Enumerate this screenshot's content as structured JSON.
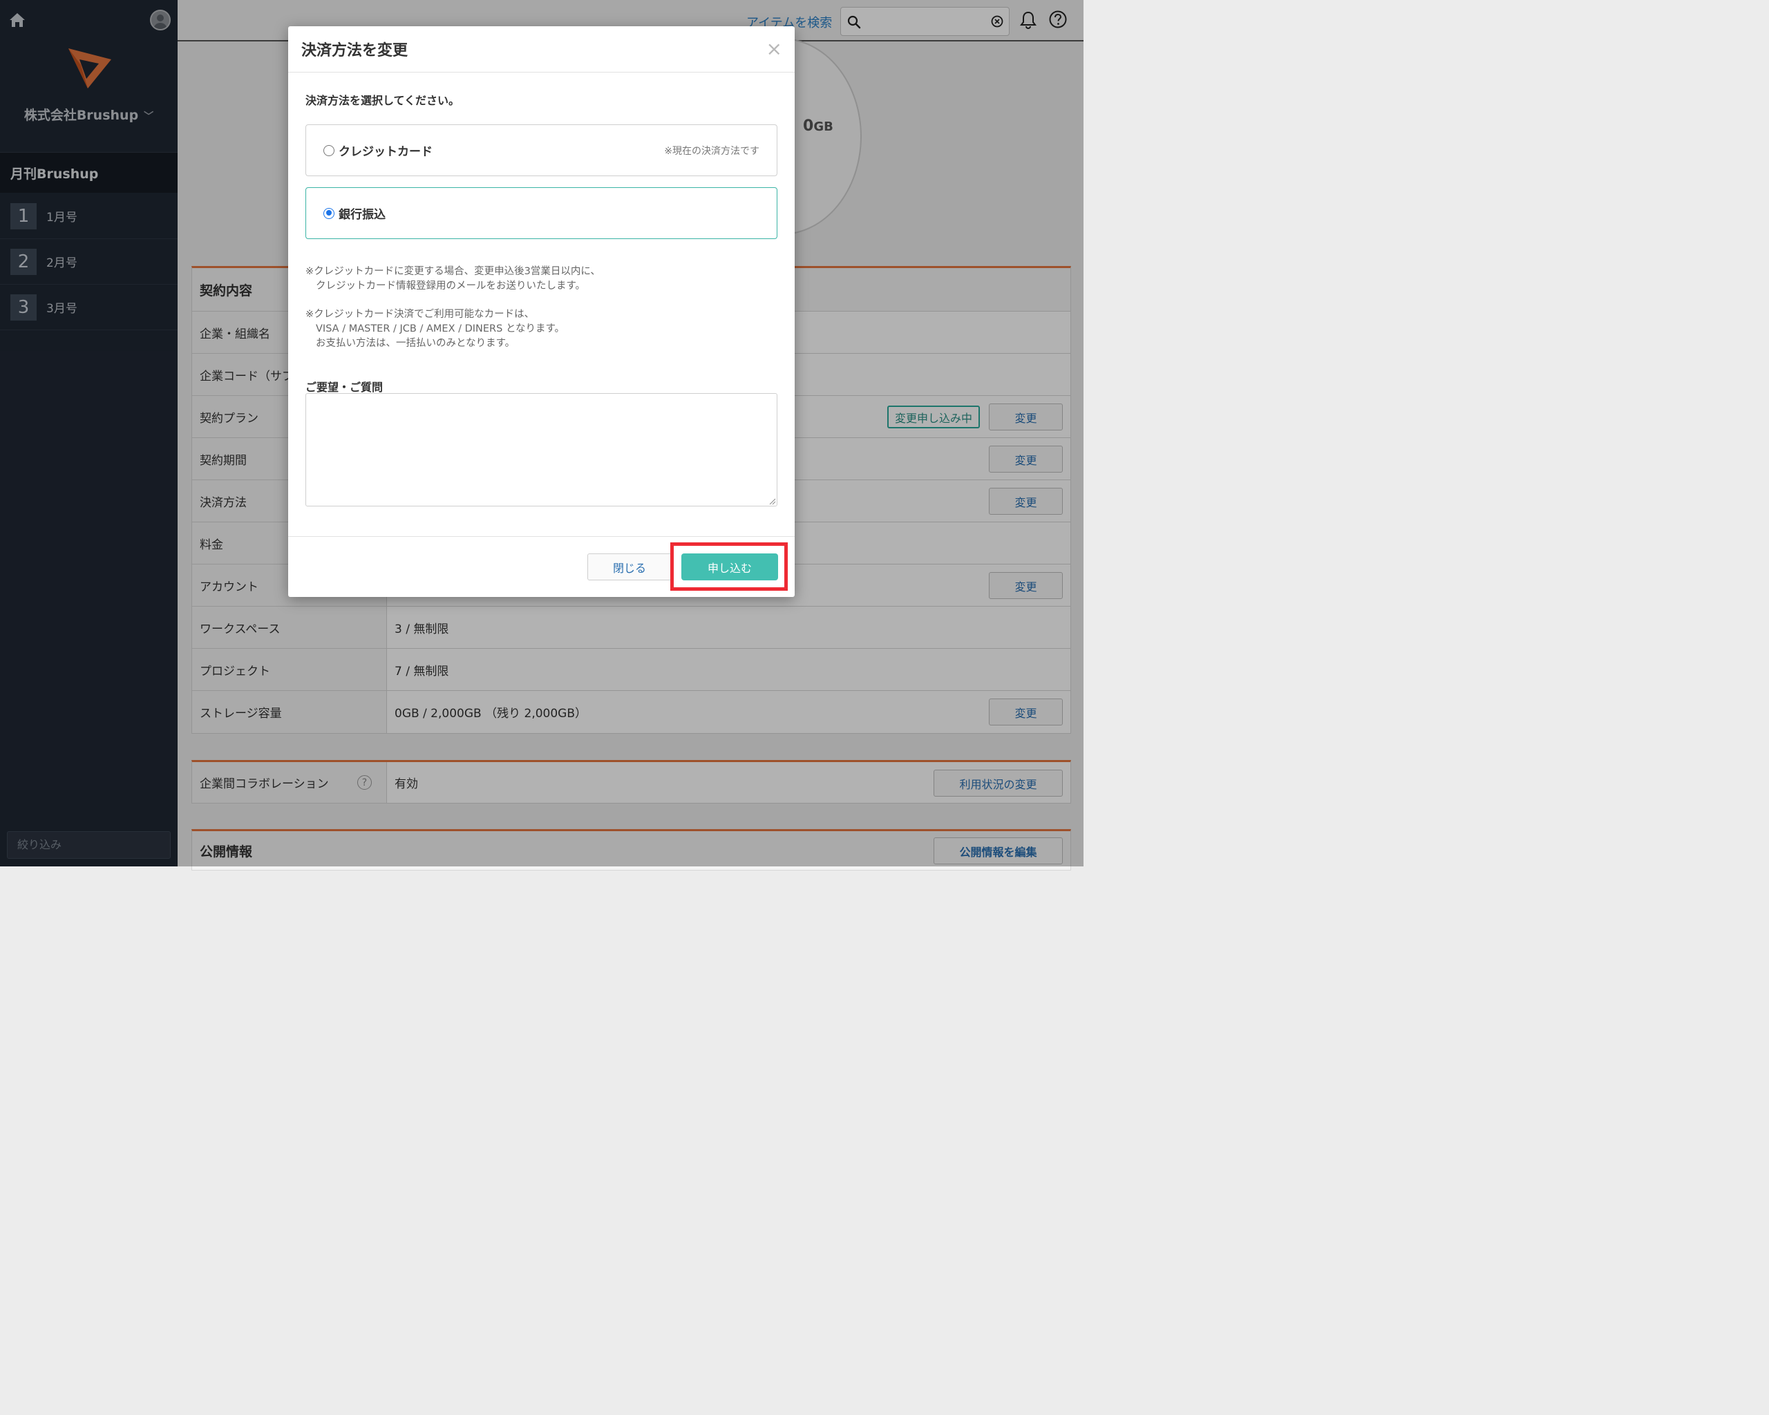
{
  "sidebar": {
    "company": "株式会社Brushup",
    "section_title": "月刊Brushup",
    "items": [
      {
        "num": "1",
        "label": "1月号"
      },
      {
        "num": "2",
        "label": "2月号"
      },
      {
        "num": "3",
        "label": "3月号"
      }
    ],
    "filter_placeholder": "絞り込み"
  },
  "header": {
    "search_link": "アイテムを検索",
    "search_value": ""
  },
  "storage_circle": {
    "value_fragment": "0",
    "unit": "GB"
  },
  "contract": {
    "title": "契約内容",
    "rows": [
      {
        "key": "企業・組織名",
        "value": ""
      },
      {
        "key": "企業コード（サブ",
        "value": ""
      },
      {
        "key": "契約プラン",
        "value": "",
        "badge": "変更申し込み中",
        "button": "変更"
      },
      {
        "key": "契約期間",
        "value": "",
        "button": "変更"
      },
      {
        "key": "決済方法",
        "value": "",
        "button": "変更"
      },
      {
        "key": "料金",
        "value": ""
      },
      {
        "key": "アカウント",
        "value": "",
        "button": "変更"
      },
      {
        "key": "ワークスペース",
        "value": "3 / 無制限"
      },
      {
        "key": "プロジェクト",
        "value": "7 / 無制限"
      },
      {
        "key": "ストレージ容量",
        "value": "0GB / 2,000GB （残り 2,000GB）",
        "button": "変更"
      }
    ]
  },
  "collaboration": {
    "key": "企業間コラボレーション",
    "value": "有効",
    "button": "利用状況の変更"
  },
  "public_info": {
    "title": "公開情報",
    "button": "公開情報を編集"
  },
  "modal": {
    "title": "決済方法を変更",
    "prompt": "決済方法を選択してください。",
    "options": [
      {
        "label": "クレジットカード",
        "note": "※現在の決済方法です",
        "selected": false
      },
      {
        "label": "銀行振込",
        "note": "",
        "selected": true
      }
    ],
    "notes": [
      "※クレジットカードに変更する場合、変更申込後3営業日以内に、",
      "クレジットカード情報登録用のメールをお送りいたします。",
      "※クレジットカード決済でご利用可能なカードは、",
      "VISA / MASTER / JCB / AMEX / DINERS となります。",
      "お支払い方法は、一括払いのみとなります。"
    ],
    "question_label": "ご要望・ご質問",
    "question_value": "",
    "close_button": "閉じる",
    "apply_button": "申し込む"
  },
  "colors": {
    "sidebar_bg": "#1f2733",
    "accent_orange": "#e3743e",
    "accent_teal": "#43bfb1",
    "link_blue": "#2a6fb0",
    "highlight_red": "#ee2a33"
  }
}
